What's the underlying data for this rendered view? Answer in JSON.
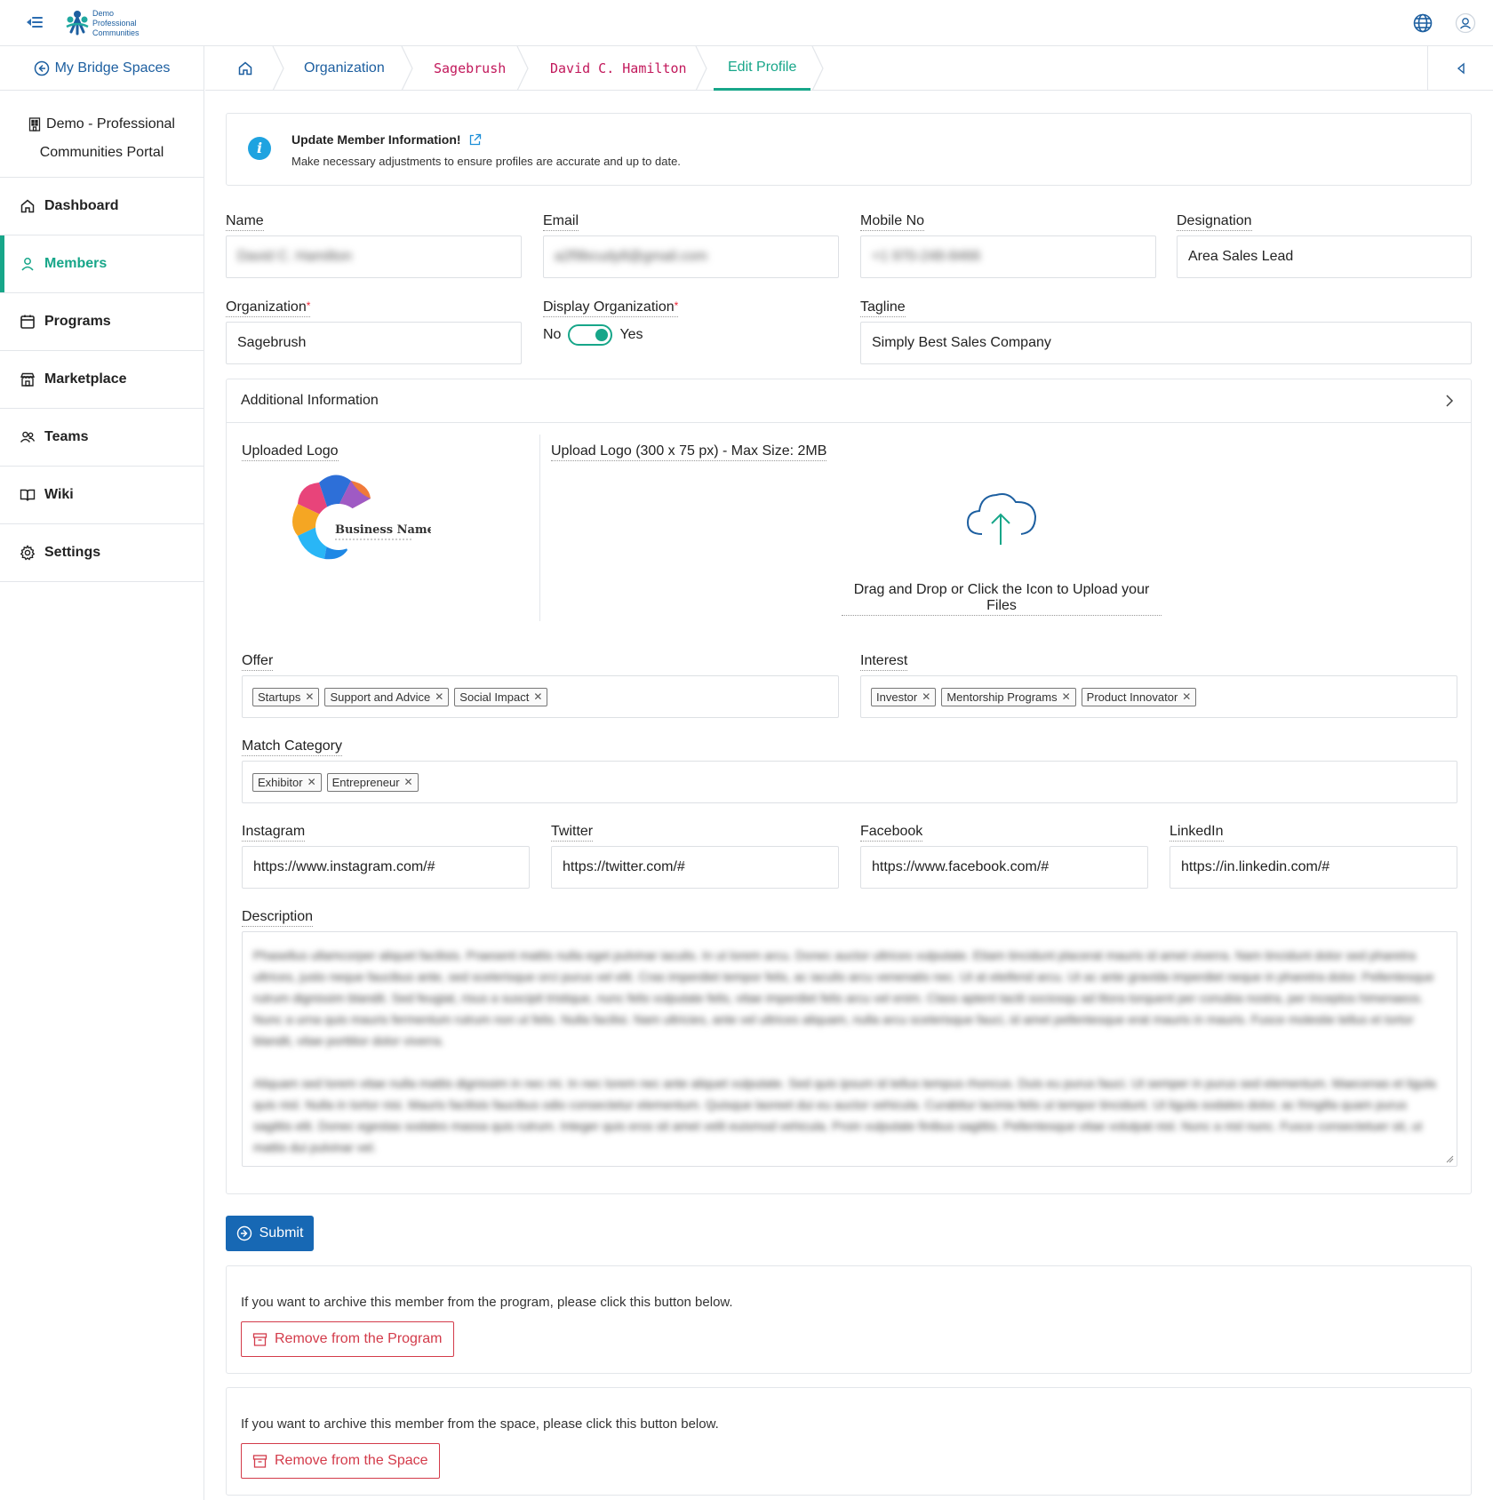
{
  "app": {
    "logo_text": [
      "Demo",
      "Professional",
      "Communities"
    ]
  },
  "sidebar": {
    "back_label": "My Bridge Spaces",
    "portal_line1": "Demo - Professional",
    "portal_line2": "Communities Portal",
    "items": [
      {
        "label": "Dashboard",
        "icon": "home-icon",
        "active": false
      },
      {
        "label": "Members",
        "icon": "user-icon",
        "active": true
      },
      {
        "label": "Programs",
        "icon": "calendar-icon",
        "active": false
      },
      {
        "label": "Marketplace",
        "icon": "store-icon",
        "active": false
      },
      {
        "label": "Teams",
        "icon": "users-icon",
        "active": false
      },
      {
        "label": "Wiki",
        "icon": "book-icon",
        "active": false
      },
      {
        "label": "Settings",
        "icon": "gear-icon",
        "active": false
      }
    ]
  },
  "breadcrumb": {
    "items": [
      {
        "label": "Organization",
        "color": "#1d5fa0"
      },
      {
        "label": "Sagebrush",
        "color": "#c2185b"
      },
      {
        "label": "David C. Hamilton",
        "color": "#c2185b"
      },
      {
        "label": "Edit Profile",
        "color": "#17a689"
      }
    ]
  },
  "alert": {
    "title": "Update Member Information!",
    "message": "Make necessary adjustments to ensure profiles are accurate and up to date."
  },
  "form": {
    "name_label": "Name",
    "name_value": "David C. Hamilton",
    "email_label": "Email",
    "email_value": "a2f9bcudy8@gmail.com",
    "mobile_label": "Mobile No",
    "mobile_value": "+1 970-248-8466",
    "designation_label": "Designation",
    "designation_value": "Area Sales Lead",
    "organization_label": "Organization",
    "organization_value": "Sagebrush",
    "display_org_label": "Display Organization",
    "toggle_no": "No",
    "toggle_yes": "Yes",
    "display_org_on": true,
    "tagline_label": "Tagline",
    "tagline_value": "Simply Best Sales Company"
  },
  "additional": {
    "title": "Additional Information",
    "uploaded_logo_label": "Uploaded Logo",
    "logo_business_name": "Business Name",
    "upload_label": "Upload Logo (300 x 75 px) - Max Size: 2MB",
    "upload_hint": "Drag and Drop or Click the Icon to Upload your Files",
    "offer_label": "Offer",
    "offer_tags": [
      "Startups",
      "Support and Advice",
      "Social Impact"
    ],
    "interest_label": "Interest",
    "interest_tags": [
      "Investor",
      "Mentorship Programs",
      "Product Innovator"
    ],
    "match_label": "Match Category",
    "match_tags": [
      "Exhibitor",
      "Entrepreneur"
    ],
    "instagram_label": "Instagram",
    "instagram_value": "https://www.instagram.com/#",
    "twitter_label": "Twitter",
    "twitter_value": "https://twitter.com/#",
    "facebook_label": "Facebook",
    "facebook_value": "https://www.facebook.com/#",
    "linkedin_label": "LinkedIn",
    "linkedin_value": "https://in.linkedin.com/#",
    "description_label": "Description",
    "description_p1": "Phasellus ullamcorper aliquet facilisis. Praesent mattis nulla eget pulvinar iaculis. In ut lorem arcu. Donec auctor ultrices vulputate. Etiam tincidunt placerat mauris id amet viverra. Nam tincidunt dolor sed pharetra ultrices, justo neque faucibus ante, sed scelerisque orci purus vel elit. Cras imperdiet tempor felis, ac iaculis arcu venenatis nec. Ut at eleifend arcu. Ut ac ante gravida imperdiet neque in pharetra dolor. Pellentesque rutrum dignissim blandit. Sed feugiat, risus a suscipit tristique, nunc felis vulputate felis, vitae imperdiet felis arcu vel enim. Class aptent taciti sociosqu ad litora torquent per conubia nostra, per inceptos himenaeos. Nunc a urna quis mauris fermentum rutrum non ut felis. Nulla facilisi. Nam ultricies, ante vel ultrices aliquam, nulla arcu scelerisque fauci, id amet pellentesque erat mauris in mauris. Fusce molestie tellus et tortor blandit, vitae porttitor dolor viverra.",
    "description_p2": "Aliquam sed lorem vitae nulla mattis dignissim in nec mi. In nec lorem nec ante aliquet vulputate. Sed quis ipsum id tellus tempus rhoncus. Duis eu purus fauci. Ut semper in purus sed elementum. Maecenas et ligula quis nisl. Nulla in tortor nisi. Mauris facilisis faucibus odio consectetur elementum. Quisque laoreet dui eu auctor vehicula. Curabitur lacinia felis ut tempor tincidunt. Ut ligula sodales dolor, ac fringilla quam purus sagittis elit. Donec egestas sodales massa quis rutrum. Integer quis eros sit amet velit euismod vehicula. Proin vulputate finibus sagittis. Pellentesque vitae volutpat nisl. Nunc a nisl nunc. Fusce consectetuer sit, ut mattis dui pulvinar vel."
  },
  "actions": {
    "submit_label": "Submit",
    "archive_program_msg": "If you want to archive this member from the program, please click this button below.",
    "remove_program_label": "Remove from the Program",
    "archive_space_msg": "If you want to archive this member from the space, please click this button below.",
    "remove_space_label": "Remove from the Space"
  }
}
